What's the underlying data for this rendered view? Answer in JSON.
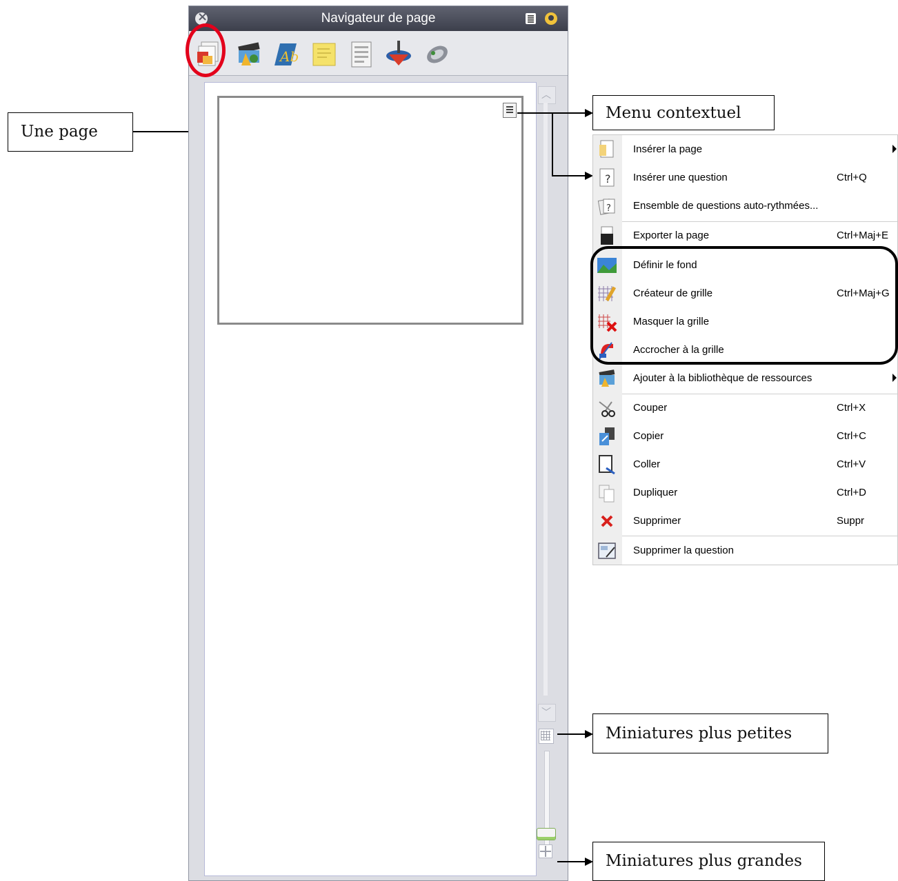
{
  "panel": {
    "title": "Navigateur de page",
    "toolbar": [
      {
        "icon": "page-sorter-icon"
      },
      {
        "icon": "resource-library-icon"
      },
      {
        "icon": "object-browser-icon"
      },
      {
        "icon": "notes-icon"
      },
      {
        "icon": "property-browser-icon"
      },
      {
        "icon": "action-browser-icon"
      },
      {
        "icon": "voting-browser-icon"
      }
    ]
  },
  "callouts": {
    "page": "Une page",
    "menu": "Menu contextuel",
    "smaller": "Miniatures plus petites",
    "larger": "Miniatures plus grandes"
  },
  "context_menu": {
    "items": [
      {
        "label": "Insérer la page",
        "shortcut": "",
        "submenu": true,
        "icon": "insert-page-icon"
      },
      {
        "label": "Insérer une question",
        "shortcut": "Ctrl+Q",
        "submenu": false,
        "icon": "insert-question-icon"
      },
      {
        "label": "Ensemble de questions auto-rythmées...",
        "shortcut": "",
        "submenu": false,
        "icon": "question-set-icon"
      },
      {
        "label": "Exporter la page",
        "shortcut": "Ctrl+Maj+E",
        "submenu": false,
        "icon": "export-page-icon"
      },
      {
        "label": "Définir le fond",
        "shortcut": "",
        "submenu": false,
        "icon": "background-icon"
      },
      {
        "label": "Créateur de grille",
        "shortcut": "Ctrl+Maj+G",
        "submenu": false,
        "icon": "grid-designer-icon"
      },
      {
        "label": "Masquer la grille",
        "shortcut": "",
        "submenu": false,
        "icon": "hide-grid-icon"
      },
      {
        "label": "Accrocher à la grille",
        "shortcut": "",
        "submenu": false,
        "icon": "snap-grid-icon"
      },
      {
        "label": "Ajouter à la bibliothèque de ressources",
        "shortcut": "",
        "submenu": true,
        "icon": "add-library-icon"
      },
      {
        "label": "Couper",
        "shortcut": "Ctrl+X",
        "submenu": false,
        "icon": "scissors-icon"
      },
      {
        "label": "Copier",
        "shortcut": "Ctrl+C",
        "submenu": false,
        "icon": "copy-icon"
      },
      {
        "label": "Coller",
        "shortcut": "Ctrl+V",
        "submenu": false,
        "icon": "paste-icon"
      },
      {
        "label": "Dupliquer",
        "shortcut": "Ctrl+D",
        "submenu": false,
        "icon": "duplicate-icon"
      },
      {
        "label": "Supprimer",
        "shortcut": "Suppr",
        "submenu": false,
        "icon": "delete-icon"
      },
      {
        "label": "Supprimer la question",
        "shortcut": "",
        "submenu": false,
        "icon": "delete-question-icon"
      }
    ]
  },
  "colors": {
    "highlight_circle": "#e3001b",
    "titlebar": "#4a4d59"
  }
}
